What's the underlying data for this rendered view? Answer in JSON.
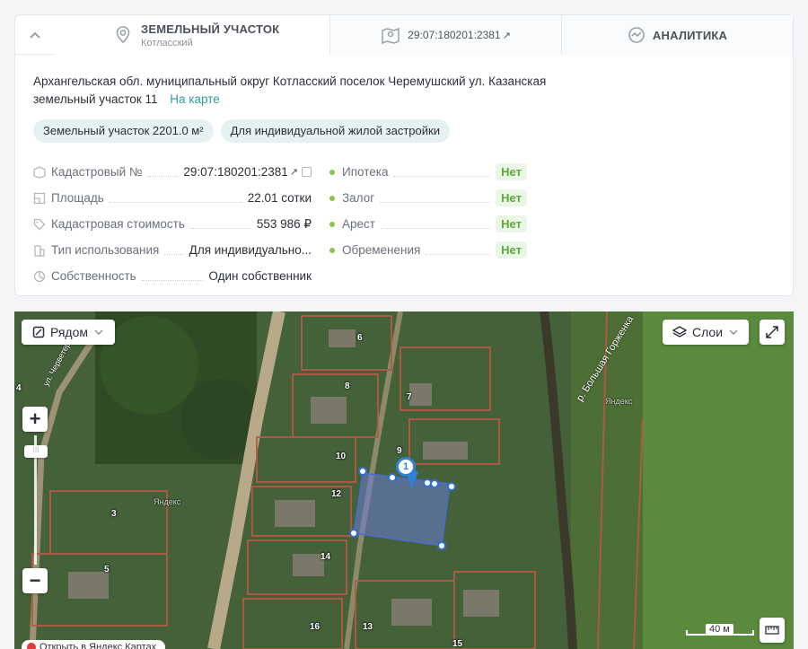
{
  "tabs": {
    "parcel": {
      "title": "ЗЕМЕЛЬНЫЙ УЧАСТОК",
      "subtitle": "Котласский"
    },
    "cadastral": {
      "label": "29:07:180201:2381",
      "arrow": "↗"
    },
    "analytics": {
      "label": "АНАЛИТИКА"
    }
  },
  "address": {
    "text": "Архангельская обл. муниципальный округ Котласский поселок Черемушский ул. Казанская земельный участок 11",
    "map_link": "На карте"
  },
  "tags": [
    "Земельный участок 2201.0 м²",
    "Для индивидуальной жилой застройки"
  ],
  "properties": [
    {
      "icon": "cadastre-icon",
      "label": "Кадастровый №",
      "value": "29:07:180201:2381",
      "link": true
    },
    {
      "icon": "area-icon",
      "label": "Площадь",
      "value": "22.01 сотки"
    },
    {
      "icon": "price-tag-icon",
      "label": "Кадастровая стоимость",
      "value": "553 986 ₽"
    },
    {
      "icon": "building-icon",
      "label": "Тип использования",
      "value": "Для индивидуально..."
    },
    {
      "icon": "ownership-icon",
      "label": "Собственность",
      "value": "Один собственник"
    }
  ],
  "flags": [
    {
      "label": "Ипотека",
      "value": "Нет"
    },
    {
      "label": "Залог",
      "value": "Нет"
    },
    {
      "label": "Арест",
      "value": "Нет"
    },
    {
      "label": "Обременения",
      "value": "Нет"
    }
  ],
  "map": {
    "near_button": "Рядом",
    "layers_button": "Слои",
    "marker": "1",
    "scale": "40 м",
    "river": "р. Большая Горженка",
    "street": "ул. Черветерская",
    "yandex": "Яндекс",
    "yandex_badge": "Открыть в Яндекс Картах",
    "plot_numbers": [
      "6",
      "8",
      "7",
      "9",
      "10",
      "12",
      "14",
      "16",
      "13",
      "4",
      "5",
      "3",
      "15"
    ],
    "colors": {
      "accent": "#2e9d9c",
      "no_badge": "#5ea93a",
      "plot": "#6a7bd6"
    }
  }
}
